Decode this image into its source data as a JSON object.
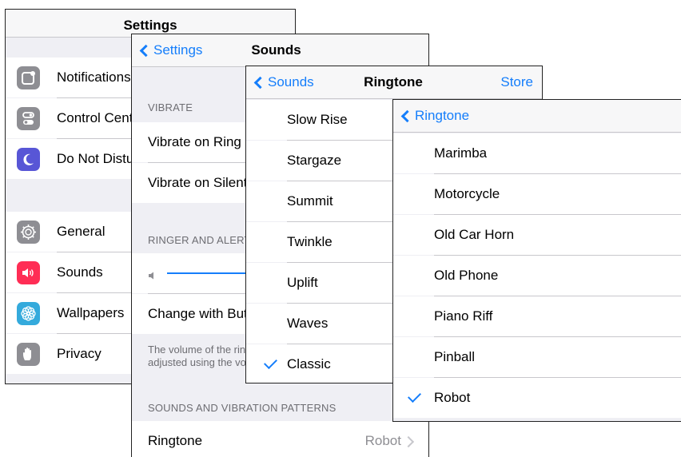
{
  "settings": {
    "title": "Settings",
    "rows": [
      {
        "label": "Notifications",
        "icon": "notifications-icon",
        "color": "#8e8e93"
      },
      {
        "label": "Control Center",
        "icon": "control-center-icon",
        "color": "#8e8e93"
      },
      {
        "label": "Do Not Disturb",
        "icon": "moon-icon",
        "color": "#5856d6"
      },
      {
        "label": "General",
        "icon": "gear-icon",
        "color": "#8e8e93"
      },
      {
        "label": "Sounds",
        "icon": "speaker-icon",
        "color": "#ff2d55"
      },
      {
        "label": "Wallpapers",
        "icon": "flower-icon",
        "color": "#34aadc"
      },
      {
        "label": "Privacy",
        "icon": "hand-icon",
        "color": "#8e8e93"
      }
    ]
  },
  "sounds": {
    "back_label": "Settings",
    "title": "Sounds",
    "vibrate_header": "VIBRATE",
    "vibrate_on_ring": "Vibrate on Ring",
    "vibrate_on_silent": "Vibrate on Silent",
    "ringer_header": "RINGER AND ALERTS",
    "change_with_buttons": "Change with Buttons",
    "footer_line1": "The volume of the ringer and alerts can be",
    "footer_line2": "adjusted using the volume buttons.",
    "patterns_header": "SOUNDS AND VIBRATION PATTERNS",
    "ringtone_label": "Ringtone",
    "ringtone_value": "Robot"
  },
  "ringtone": {
    "back_label": "Sounds",
    "title": "Ringtone",
    "store_label": "Store",
    "items": [
      "Slow Rise",
      "Stargaze",
      "Summit",
      "Twinkle",
      "Uplift",
      "Waves",
      "Classic"
    ],
    "checked": "Classic"
  },
  "classic": {
    "back_label": "Ringtone",
    "items": [
      "Marimba",
      "Motorcycle",
      "Old Car Horn",
      "Old Phone",
      "Piano Riff",
      "Pinball",
      "Robot"
    ],
    "checked": "Robot"
  },
  "colors": {
    "accent": "#157efb",
    "background": "#efeff4",
    "separator": "#c8c7cc"
  }
}
